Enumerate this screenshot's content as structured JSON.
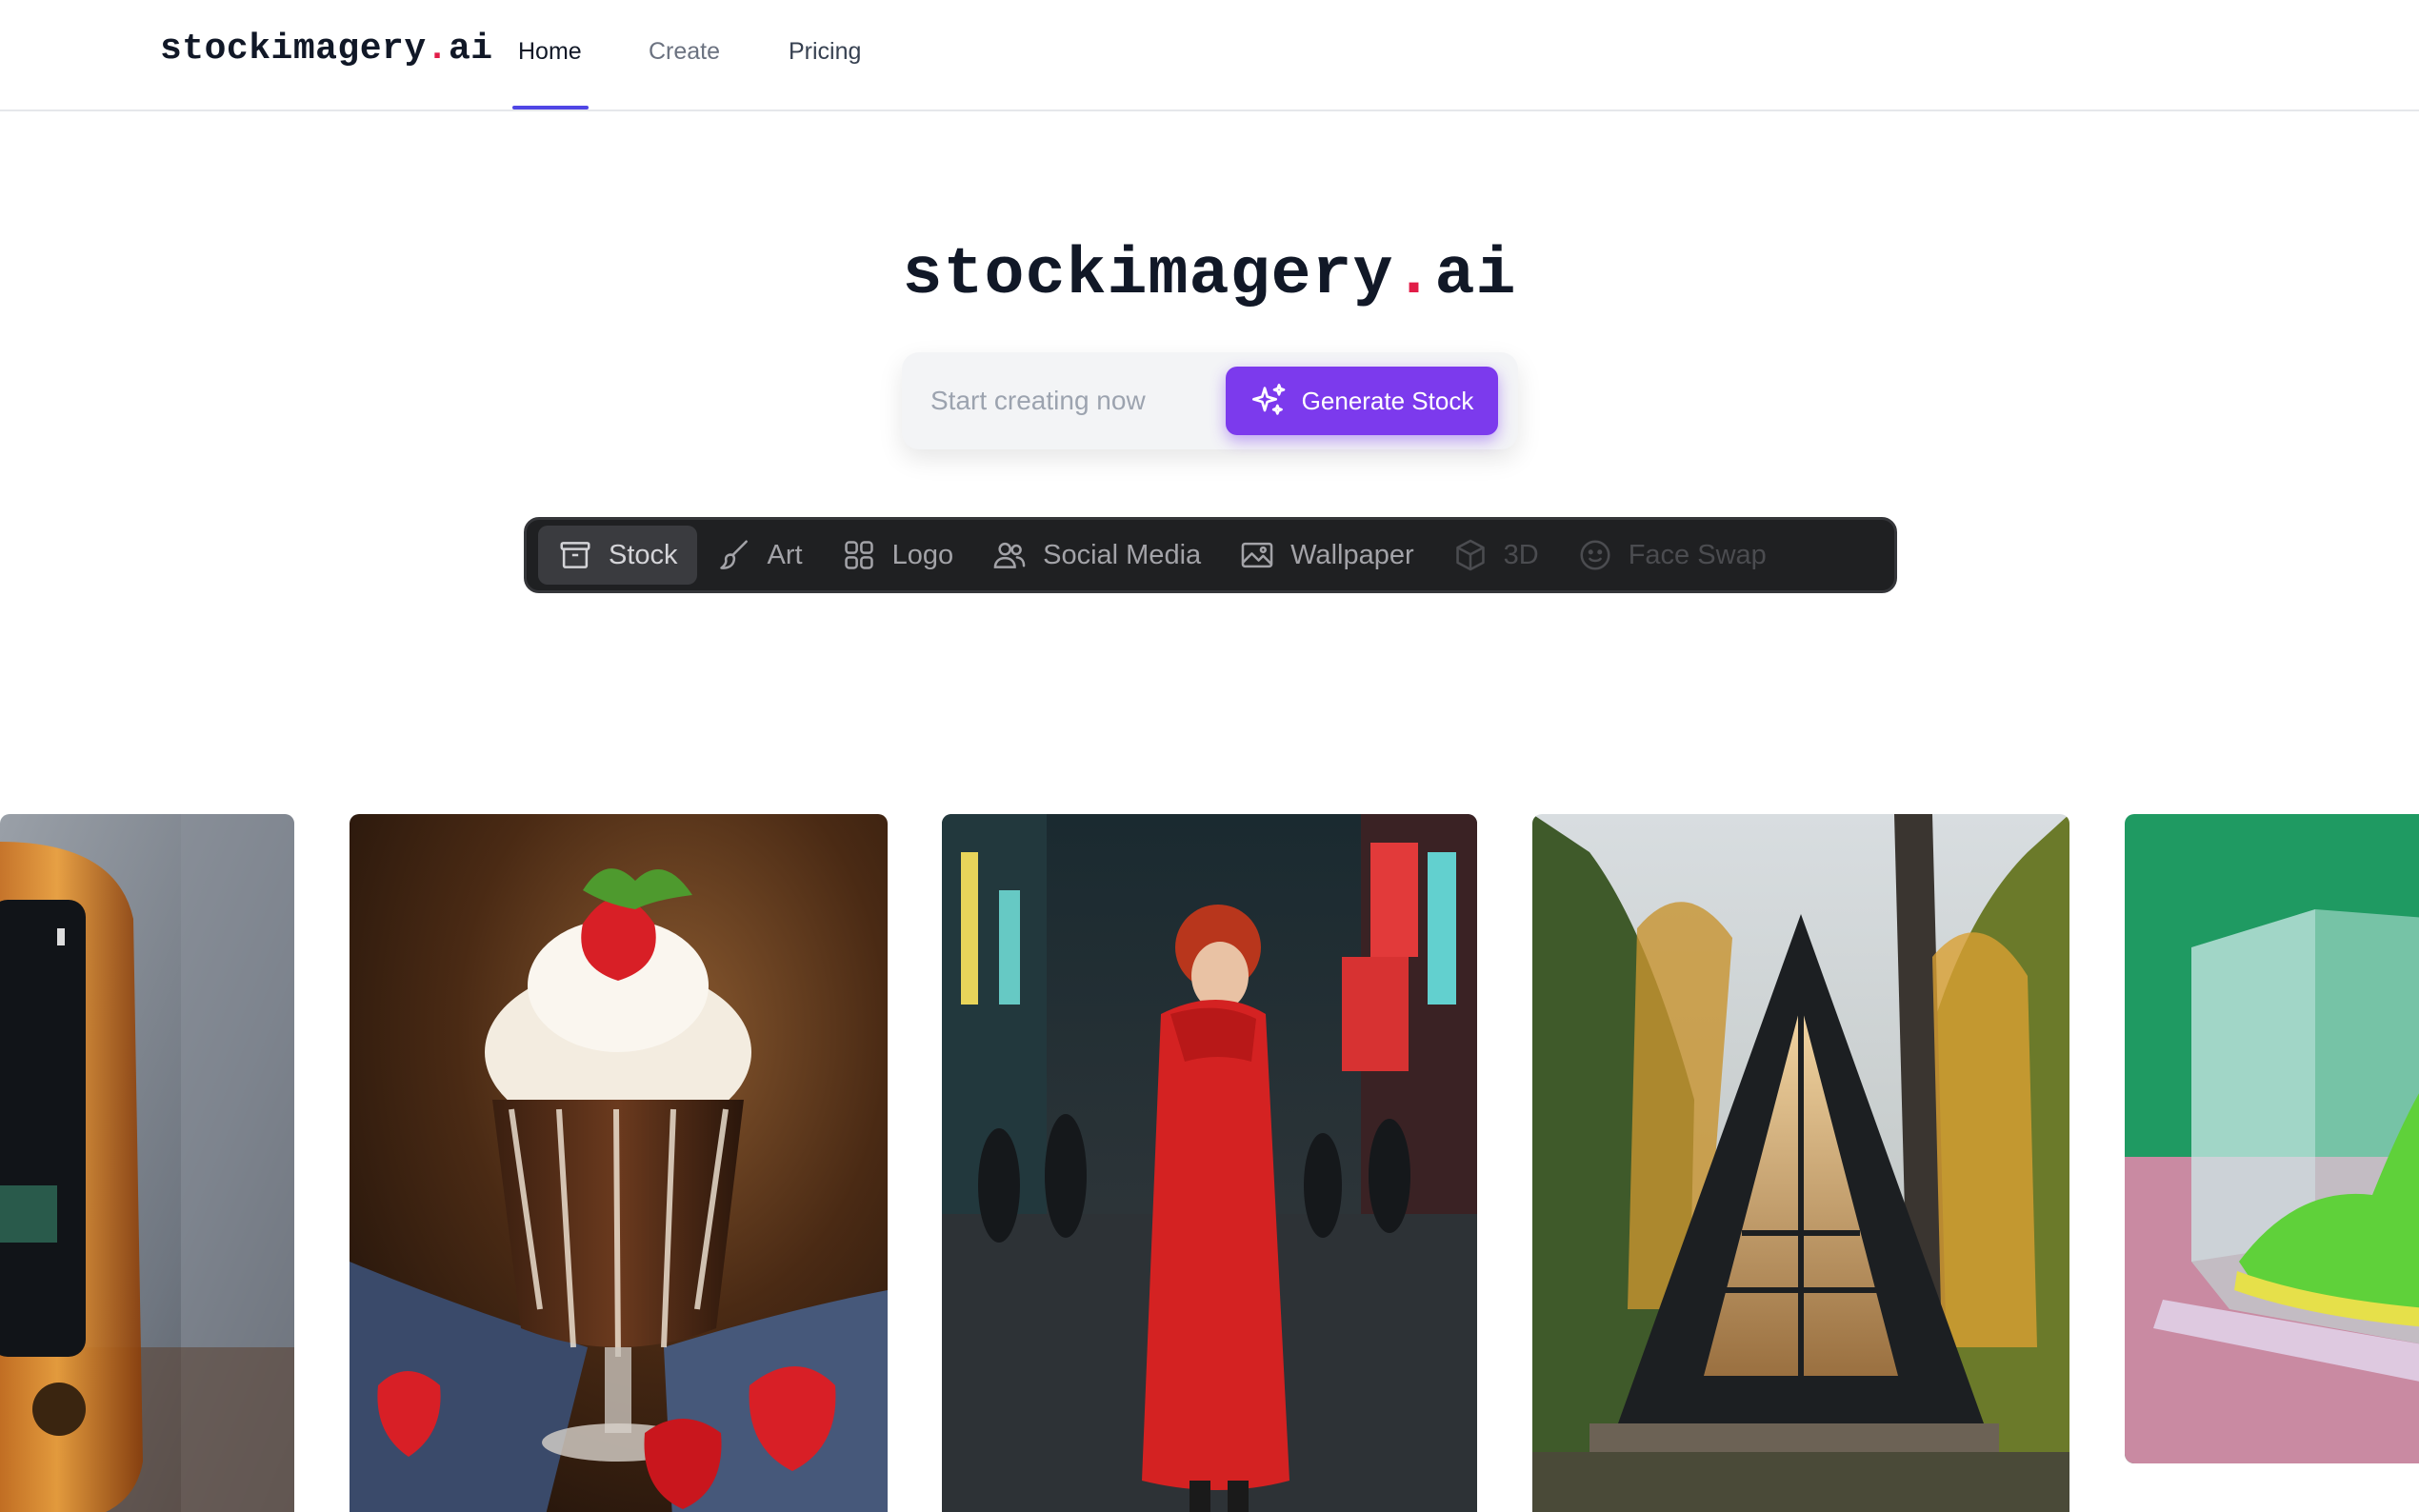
{
  "brand": {
    "name": "stockimagery",
    "dot": ".",
    "tld": "ai"
  },
  "nav": {
    "items": [
      {
        "label": "Home",
        "active": true
      },
      {
        "label": "Create",
        "active": false
      },
      {
        "label": "Pricing",
        "active": false
      }
    ]
  },
  "hero": {
    "title_name": "stockimagery",
    "title_dot": ".",
    "title_tld": "ai",
    "search_placeholder": "Start creating now",
    "generate_label": "Generate Stock",
    "generate_icon": "sparkles-icon"
  },
  "categories": [
    {
      "label": "Stock",
      "icon": "archive-box-icon",
      "state": "active"
    },
    {
      "label": "Art",
      "icon": "paint-brush-icon",
      "state": "normal"
    },
    {
      "label": "Logo",
      "icon": "grid-squares-icon",
      "state": "normal"
    },
    {
      "label": "Social Media",
      "icon": "users-icon",
      "state": "normal"
    },
    {
      "label": "Wallpaper",
      "icon": "image-icon",
      "state": "normal"
    },
    {
      "label": "3D",
      "icon": "cube-icon",
      "state": "disabled"
    },
    {
      "label": "Face Swap",
      "icon": "smiley-face-icon",
      "state": "disabled"
    }
  ],
  "gallery": [
    {
      "subject": "transparent orange smartphone"
    },
    {
      "subject": "chocolate sundae with strawberries"
    },
    {
      "subject": "woman in red raincoat on city street at night"
    },
    {
      "subject": "black a-frame cabin in autumn forest"
    },
    {
      "subject": "green sneaker in acrylic box"
    }
  ],
  "colors": {
    "accent": "#7c3aed",
    "nav_underline": "#4f46e5",
    "brand_dot": "#e11d48",
    "catbar_bg": "#1f2022"
  }
}
